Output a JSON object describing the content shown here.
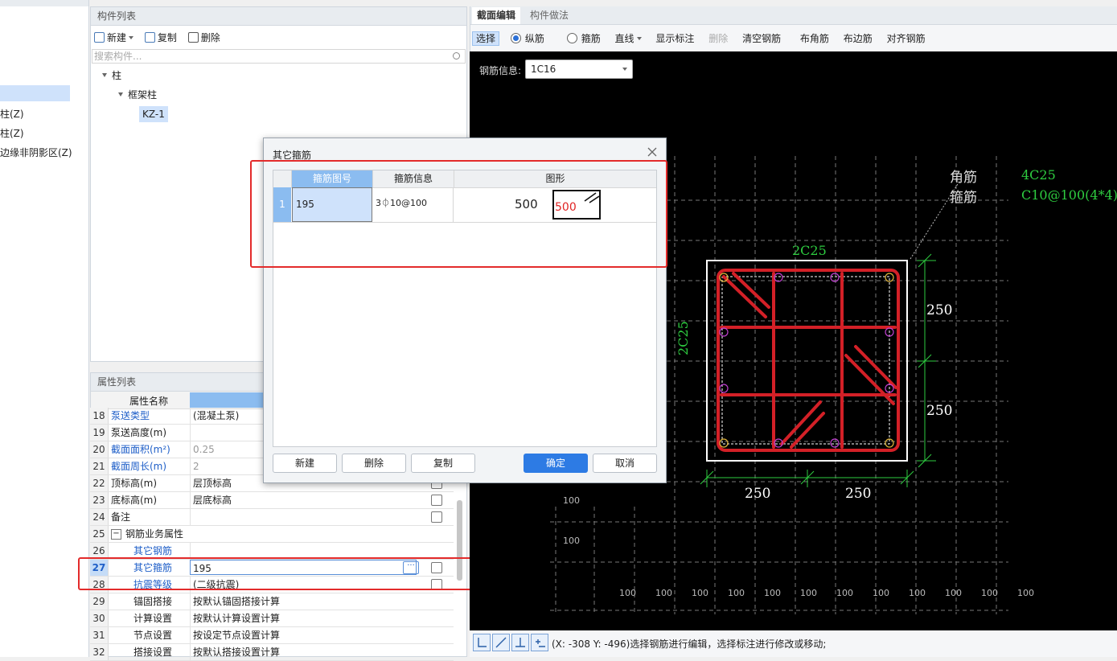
{
  "left_tree": {
    "items": [
      "柱(Z)",
      "柱(Z)",
      "边缘非阴影区(Z)"
    ]
  },
  "component_list": {
    "title": "构件列表",
    "toolbar": {
      "new": "新建",
      "copy": "复制",
      "delete": "删除"
    },
    "search_placeholder": "搜索构件...",
    "tree": {
      "root": "柱",
      "child": "框架柱",
      "leaf": "KZ-1"
    }
  },
  "property_list": {
    "title": "属性列表",
    "header_name": "属性名称",
    "rows": [
      {
        "num": "18",
        "name": "泵送类型",
        "value": "(混凝土泵)"
      },
      {
        "num": "19",
        "name": "泵送高度(m)",
        "value": ""
      },
      {
        "num": "20",
        "name": "截面面积(m²)",
        "value": "0.25"
      },
      {
        "num": "21",
        "name": "截面周长(m)",
        "value": "2"
      },
      {
        "num": "22",
        "name": "顶标高(m)",
        "value": "层顶标高"
      },
      {
        "num": "23",
        "name": "底标高(m)",
        "value": "层底标高"
      },
      {
        "num": "24",
        "name": "备注",
        "value": ""
      },
      {
        "num": "25",
        "name": "钢筋业务属性",
        "value": ""
      },
      {
        "num": "26",
        "name": "其它钢筋",
        "value": ""
      },
      {
        "num": "27",
        "name": "其它箍筋",
        "value": "195"
      },
      {
        "num": "28",
        "name": "抗震等级",
        "value": "(二级抗震)"
      },
      {
        "num": "29",
        "name": "锚固搭接",
        "value": "按默认锚固搭接计算"
      },
      {
        "num": "30",
        "name": "计算设置",
        "value": "按默认计算设置计算"
      },
      {
        "num": "31",
        "name": "节点设置",
        "value": "按设定节点设置计算"
      },
      {
        "num": "32",
        "name": "搭接设置",
        "value": "按默认搭接设置计算"
      }
    ],
    "expand_symbol": "−",
    "more_symbol": "···"
  },
  "section_editor": {
    "tabs": [
      "截面编辑",
      "构件做法"
    ],
    "toolbar": {
      "select": "选择",
      "longitudinal": "纵筋",
      "stirrup": "箍筋",
      "line": "直线",
      "show_dims": "显示标注",
      "delete": "删除",
      "clear": "清空钢筋",
      "corner": "布角筋",
      "edge": "布边筋",
      "align": "对齐钢筋"
    },
    "rebar_info_label": "钢筋信息:",
    "rebar_info_value": "1C16",
    "canvas": {
      "legend_corner": "角筋",
      "legend_stirrup": "箍筋",
      "corner_spec": "4C25",
      "stirrup_spec": "C10@100(4*4)",
      "top_bars": "2C25",
      "side_bars": "2C25",
      "dim_right_top": "250",
      "dim_right_bottom": "250",
      "dim_bottom_left": "250",
      "dim_bottom_right": "250",
      "grid_left_1": "100",
      "grid_left_2": "100",
      "grid_bottom": [
        "100",
        "100",
        "100",
        "100",
        "100",
        "100",
        "100",
        "100",
        "100",
        "100",
        "100",
        "100",
        "100"
      ]
    }
  },
  "status_bar": {
    "text": "(X: -308 Y: -496)选择钢筋进行编辑，选择标注进行修改或移动;"
  },
  "dialog": {
    "title": "其它箍筋",
    "columns": [
      "箍筋图号",
      "箍筋信息",
      "图形"
    ],
    "row": {
      "num": "1",
      "code": "195",
      "info": "3⏀10@100",
      "shape_value": "500",
      "shape_label": "500"
    },
    "buttons": {
      "new": "新建",
      "delete": "删除",
      "copy": "复制",
      "ok": "确定",
      "cancel": "取消"
    }
  }
}
